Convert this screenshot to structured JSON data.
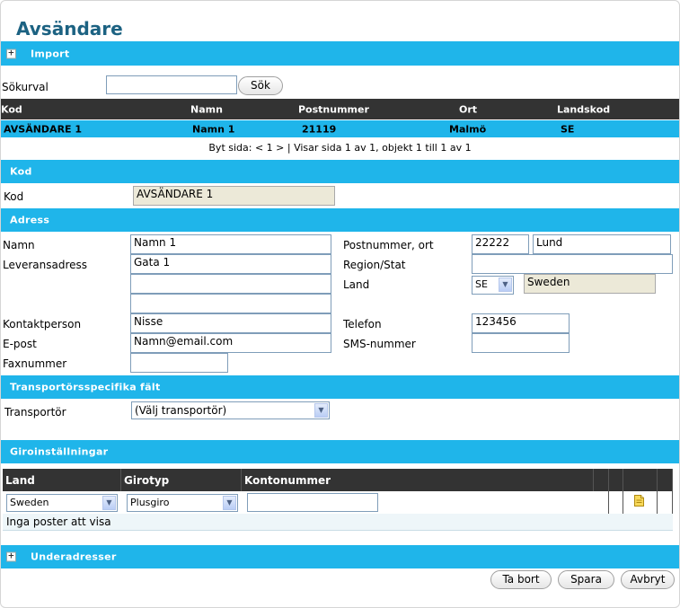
{
  "page_title": "Avsändare",
  "import": {
    "label": "Import",
    "toggle": "+"
  },
  "search": {
    "label": "Sökurval",
    "value": "",
    "button": "Sök"
  },
  "results": {
    "columns": [
      "Kod",
      "Namn",
      "Postnummer",
      "Ort",
      "Landskod"
    ],
    "rows": [
      {
        "kod": "AVSÄNDARE 1",
        "namn": "Namn 1",
        "postnummer": "21119",
        "ort": "Malmö",
        "landskod": "SE"
      }
    ],
    "pagination": "Byt sida: < 1 > | Visar sida 1 av 1, objekt 1 till 1 av 1"
  },
  "kod_section": {
    "header": "Kod",
    "label": "Kod",
    "value": "AVSÄNDARE 1"
  },
  "adress": {
    "header": "Adress",
    "namn_label": "Namn",
    "namn": "Namn 1",
    "leverans_label": "Leveransadress",
    "leverans1": "Gata 1",
    "leverans2": "",
    "leverans3": "",
    "kontakt_label": "Kontaktperson",
    "kontakt": "Nisse",
    "epost_label": "E-post",
    "epost": "Namn@email.com",
    "fax_label": "Faxnummer",
    "fax": "",
    "postnr_label": "Postnummer, ort",
    "postnr": "22222",
    "ort": "Lund",
    "region_label": "Region/Stat",
    "region": "",
    "land_label": "Land",
    "land_code": "SE",
    "land_name": "Sweden",
    "telefon_label": "Telefon",
    "telefon": "123456",
    "sms_label": "SMS-nummer",
    "sms": ""
  },
  "transport": {
    "header": "Transportörsspecifika fält",
    "label": "Transportör",
    "selected": "(Välj transportör)"
  },
  "giro": {
    "header": "Giroinställningar",
    "columns": [
      "Land",
      "Girotyp",
      "Kontonummer"
    ],
    "land": "Sweden",
    "girotyp": "Plusgiro",
    "kontonummer": "",
    "empty_text": "Inga poster att visa"
  },
  "underadresser": {
    "label": "Underadresser",
    "toggle": "+"
  },
  "actions": {
    "delete": "Ta bort",
    "save": "Spara",
    "cancel": "Avbryt"
  },
  "colors": {
    "accent": "#1fb5ea",
    "title": "#1c6282",
    "header_dark": "#333333"
  }
}
